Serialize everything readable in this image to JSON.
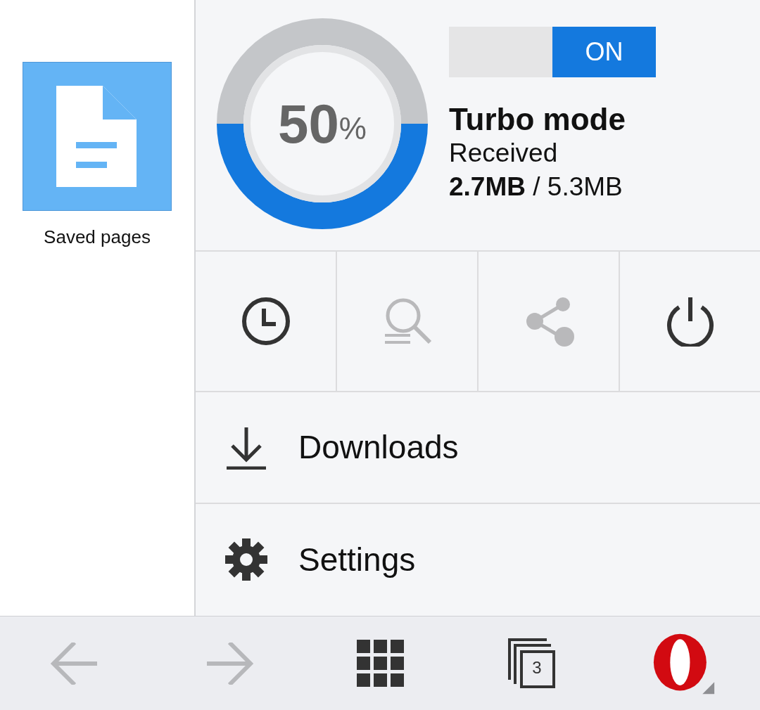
{
  "speed_dial": [
    {
      "label": "Saved pages"
    }
  ],
  "turbo": {
    "toggle": {
      "label": "ON",
      "on": true
    },
    "gauge": {
      "level": 0.5,
      "value": "50",
      "unit": "%"
    },
    "title": "Turbo mode",
    "caption": "Received",
    "amount": "**2.7MB** / 5.3MB"
  },
  "quick_actions": [
    {
      "kind": "history",
      "disabled": false
    },
    {
      "kind": "find",
      "disabled": true
    },
    {
      "kind": "share",
      "disabled": true
    },
    {
      "kind": "exit",
      "disabled": false
    }
  ],
  "menu_items": [
    {
      "kind": "downloads",
      "label": "Downloads"
    },
    {
      "kind": "settings",
      "label": "Settings"
    }
  ],
  "bottom_bar": {
    "back_disabled": true,
    "forward_disabled": true,
    "tab_count": "3"
  }
}
